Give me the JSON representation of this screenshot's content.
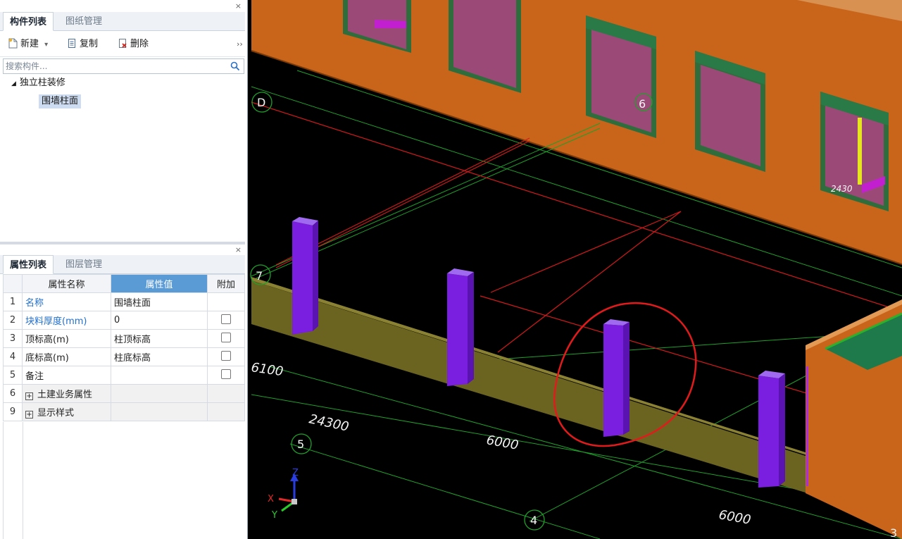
{
  "component_panel": {
    "close_glyph": "×",
    "tabs": [
      "构件列表",
      "图纸管理"
    ],
    "toolbar": {
      "new_label": "新建",
      "new_dropdown": "▾",
      "copy_label": "复制",
      "delete_label": "删除",
      "more": "››"
    },
    "search": {
      "placeholder": "搜索构件..."
    },
    "tree": {
      "root_arrow": "◢",
      "root_label": "独立柱装修",
      "child_label": "围墙柱面"
    }
  },
  "property_panel": {
    "close_glyph": "×",
    "tabs": [
      "属性列表",
      "图层管理"
    ],
    "headers": {
      "name": "属性名称",
      "value": "属性值",
      "extra": "附加"
    },
    "rows": [
      {
        "num": "1",
        "name": "名称",
        "value": "围墙柱面"
      },
      {
        "num": "2",
        "name": "块料厚度(mm)",
        "value": "0"
      },
      {
        "num": "3",
        "name": "顶标高(m)",
        "value": "柱顶标高"
      },
      {
        "num": "4",
        "name": "底标高(m)",
        "value": "柱底标高"
      },
      {
        "num": "5",
        "name": "备注",
        "value": ""
      },
      {
        "num": "6",
        "name": "土建业务属性",
        "value": "",
        "expand": "+"
      },
      {
        "num": "9",
        "name": "显示样式",
        "value": "",
        "expand": "+"
      }
    ]
  },
  "viewport": {
    "axis_labels": {
      "d": "D",
      "seven": "7",
      "six": "6",
      "five": "5",
      "four": "4",
      "three": "3"
    },
    "dimensions": {
      "d6100": "6100",
      "d24300": "24300",
      "d6000a": "6000",
      "d6000b": "6000"
    },
    "gizmo": {
      "x": "X",
      "y": "Y",
      "z": "Z"
    },
    "colors": {
      "wall": "#c8651a",
      "window_glass": "#9b4a78",
      "window_frame": "#2f6e3c",
      "column": "#7a1fe0",
      "fence_wall": "#6a6420",
      "axis_green": "#1fa02a",
      "axis_red": "#d21a1a",
      "annotation_red": "#e11b1b"
    }
  }
}
